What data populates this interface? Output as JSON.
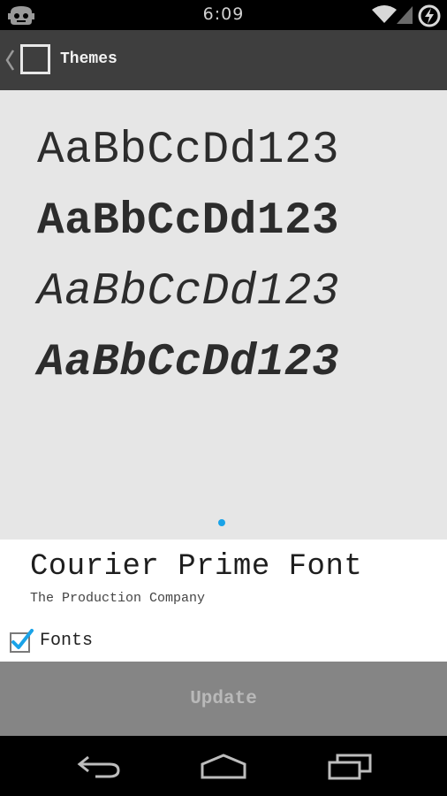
{
  "status_bar": {
    "time": "6:09",
    "icons": [
      "cyanogenmod-icon",
      "wifi-icon",
      "signal-icon",
      "battery-charging-icon"
    ]
  },
  "action_bar": {
    "title": "Themes",
    "icons": [
      "back-chevron-icon",
      "app-icon"
    ]
  },
  "preview": {
    "samples": [
      {
        "text": "AaBbCcDd123",
        "style": "regular"
      },
      {
        "text": "AaBbCcDd123",
        "style": "bold"
      },
      {
        "text": "AaBbCcDd123",
        "style": "italic"
      },
      {
        "text": "AaBbCcDd123",
        "style": "bold-italic"
      }
    ],
    "page_indicator_color": "#1aa3e8"
  },
  "theme": {
    "name": "Courier Prime Font",
    "author": "The Production Company",
    "component_label": "Fonts",
    "component_checked": true
  },
  "update_button": {
    "label": "Update"
  },
  "nav_bar": {
    "icons": [
      "back-icon",
      "home-icon",
      "recents-icon"
    ]
  },
  "colors": {
    "action_bar_bg": "#3e3e3e",
    "preview_bg": "#e6e6e6",
    "accent": "#1aa3e8",
    "button_bg": "#858585"
  }
}
